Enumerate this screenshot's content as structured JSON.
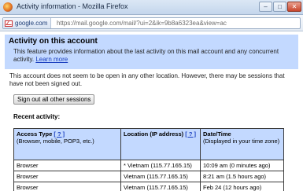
{
  "window": {
    "title": "Activity information - Mozilla Firefox",
    "minimize": "–",
    "maximize": "□",
    "close": "✕"
  },
  "address": {
    "site_name": "google.com",
    "url": "https://mail.google.com/mail/?ui=2&ik=9b8a6323ea&view=ac"
  },
  "header": {
    "title": "Activity on this account",
    "description": "This feature provides information about the last activity on this mail account and any concurrent activity.",
    "learn_more": "Learn more"
  },
  "notice": "This account does not seem to be open in any other location. However, there may be sessions that have not been signed out.",
  "signout_button": "Sign out all other sessions",
  "recent_activity_label": "Recent activity:",
  "table": {
    "col1_header": "Access Type",
    "col1_help": "[ ? ]",
    "col1_sub": "(Browser, mobile, POP3, etc.)",
    "col2_header": "Location (IP address)",
    "col2_help": "[ ? ]",
    "col3_header": "Date/Time",
    "col3_sub": "(Displayed in your time zone)",
    "rows": [
      {
        "access": "Browser",
        "location": "* Vietnam (115.77.165.15)",
        "time": "10:09 am (0 minutes ago)"
      },
      {
        "access": "Browser",
        "location": "Vietnam (115.77.165.15)",
        "time": "8:21 am (1.5 hours ago)"
      },
      {
        "access": "Browser",
        "location": "Vietnam (115.77.165.15)",
        "time": "Feb 24 (12 hours ago)"
      }
    ]
  }
}
